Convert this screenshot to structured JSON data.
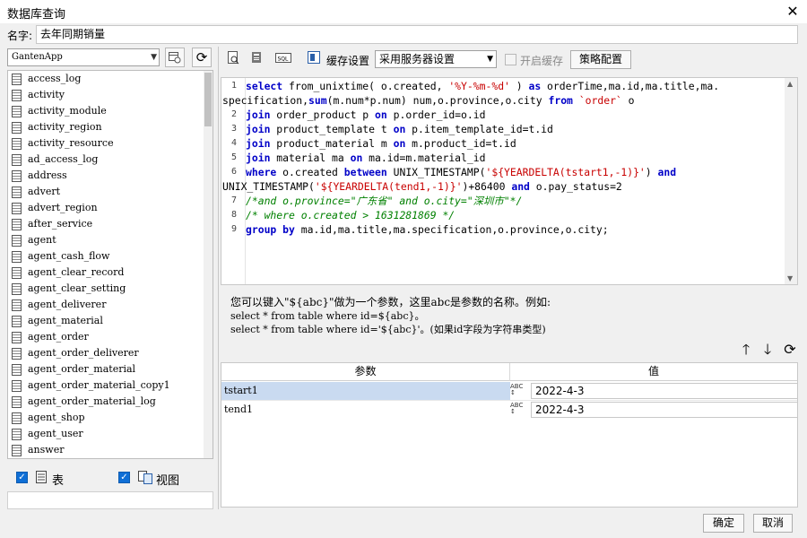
{
  "window": {
    "title": "数据库查询",
    "close_glyph": "✕"
  },
  "name_field": {
    "label": "名字:",
    "value": "去年同期销量"
  },
  "left": {
    "database": "GantenApp",
    "tables": [
      "access_log",
      "activity",
      "activity_module",
      "activity_region",
      "activity_resource",
      "ad_access_log",
      "address",
      "advert",
      "advert_region",
      "after_service",
      "agent",
      "agent_cash_flow",
      "agent_clear_record",
      "agent_clear_setting",
      "agent_deliverer",
      "agent_material",
      "agent_order",
      "agent_order_deliverer",
      "agent_order_material",
      "agent_order_material_copy1",
      "agent_order_material_log",
      "agent_shop",
      "agent_user",
      "answer"
    ],
    "show_tables_label": "表",
    "show_views_label": "视图"
  },
  "toolbar": {
    "cache_settings_label": "缓存设置",
    "cache_mode_value": "采用服务器设置",
    "enable_cache_label": "开启缓存",
    "strategy_label": "策略配置"
  },
  "editor": {
    "line_numbers": [
      "1",
      "2",
      "3",
      "4",
      "5",
      "6",
      "7",
      "8",
      "9"
    ]
  },
  "hint": {
    "line1": "您可以键入\"${abc}\"做为一个参数，这里abc是参数的名称。例如:",
    "line2": "select * from table where id=${abc}。",
    "line3": "select * from table where id='${abc}'。(如果id字段为字符串类型)"
  },
  "params": {
    "header_name": "参数",
    "header_value": "值",
    "rows": [
      {
        "name": "tstart1",
        "value": "2022-4-3"
      },
      {
        "name": "tend1",
        "value": "2022-4-3"
      }
    ]
  },
  "footer": {
    "ok_label": "确定",
    "cancel_label": "取消"
  }
}
